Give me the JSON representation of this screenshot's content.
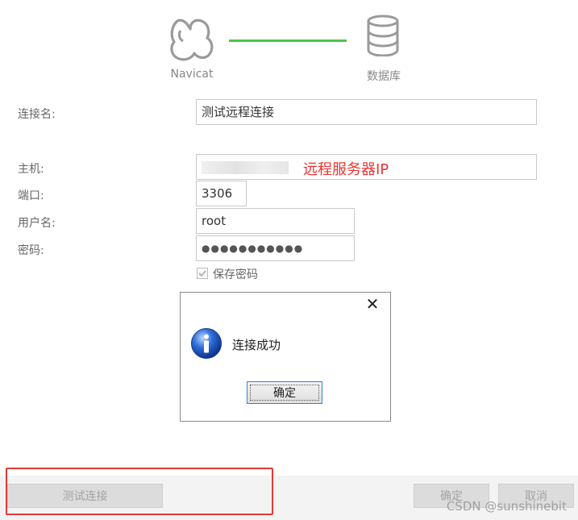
{
  "header": {
    "navicat_caption": "Navicat",
    "database_caption": "数据库"
  },
  "form": {
    "connection_name_label": "连接名:",
    "connection_name_value": "测试远程连接",
    "host_label": "主机:",
    "host_value": "",
    "host_note": "远程服务器IP",
    "port_label": "端口:",
    "port_value": "3306",
    "username_label": "用户名:",
    "username_value": "root",
    "password_label": "密码:",
    "password_value": "●●●●●●●●●●●",
    "save_password_label": "保存密码",
    "save_password_checked": true
  },
  "dialog": {
    "message": "连接成功",
    "ok_label": "确定"
  },
  "footer": {
    "test_connection_label": "测试连接",
    "ok_label": "确定",
    "cancel_label": "取消"
  },
  "watermark": "CSDN @sunshinebit",
  "colors": {
    "progress_line": "#4cc34c",
    "annotation_red": "#ee3333",
    "highlight_border": "#e53935",
    "dialog_button_border": "#3c7fd8"
  }
}
